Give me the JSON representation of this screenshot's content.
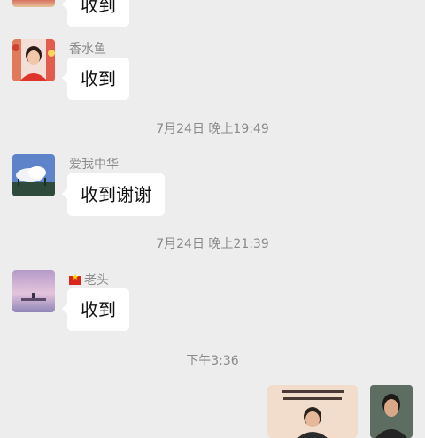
{
  "messages": [
    {
      "sender": "",
      "text": "收到"
    },
    {
      "sender": "香水鱼",
      "text": "收到"
    },
    {
      "sender": "爱我中华",
      "text": "收到谢谢"
    },
    {
      "sender": "老头",
      "text": "收到"
    }
  ],
  "timestamps": [
    "7月24日 晚上19:49",
    "7月24日 晚上21:39",
    "下午3:36"
  ],
  "colors": {
    "background": "#ededed",
    "bubble": "#ffffff",
    "meta_text": "#8a8a8a"
  }
}
